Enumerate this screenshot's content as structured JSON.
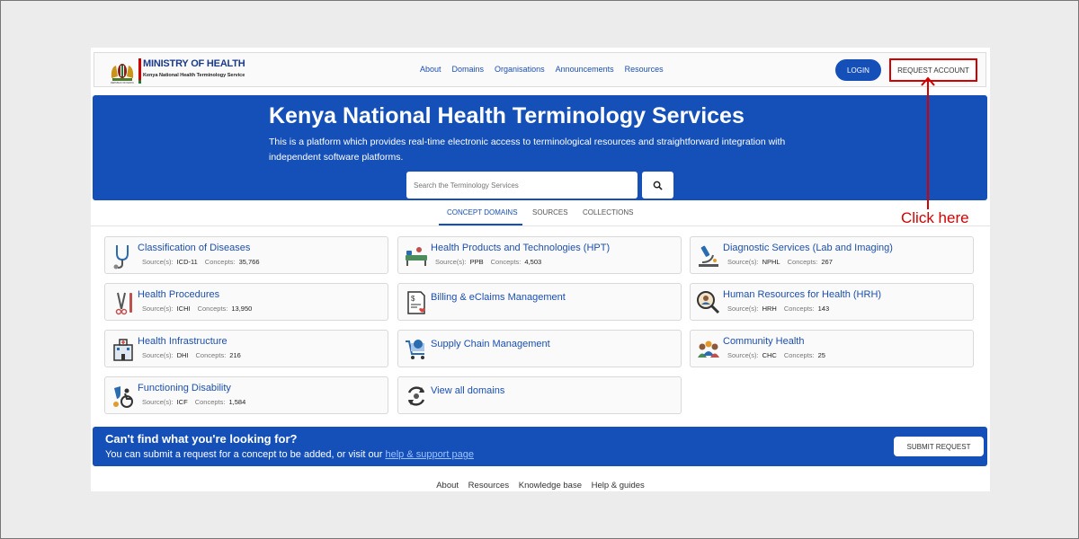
{
  "header": {
    "logo_title": "MINISTRY OF HEALTH",
    "logo_subtitle": "Kenya National Health Terminology Service",
    "nav": [
      "About",
      "Domains",
      "Organisations",
      "Announcements",
      "Resources"
    ],
    "login_label": "LOGIN",
    "request_account_label": "REQUEST ACCOUNT"
  },
  "hero": {
    "title": "Kenya National Health Terminology Services",
    "description": "This is a platform which provides real-time electronic access to terminological resources and straightforward integration with independent software platforms.",
    "search_placeholder": "Search the Terminology Services"
  },
  "tabs": [
    "CONCEPT DOMAINS",
    "SOURCES",
    "COLLECTIONS"
  ],
  "labels": {
    "source": "Source(s):",
    "concepts": "Concepts:"
  },
  "cards": [
    {
      "title": "Classification of Diseases",
      "source": "ICD-11",
      "concepts": "35,766",
      "icon": "stethoscope-icon"
    },
    {
      "title": "Health Products and Technologies (HPT)",
      "source": "PPB",
      "concepts": "4,503",
      "icon": "hospital-bed-icon"
    },
    {
      "title": "Diagnostic Services (Lab and Imaging)",
      "source": "NPHL",
      "concepts": "267",
      "icon": "microscope-icon"
    },
    {
      "title": "Health Procedures",
      "source": "ICHI",
      "concepts": "13,950",
      "icon": "surgical-tools-icon"
    },
    {
      "title": "Billing & eClaims Management",
      "icon": "invoice-icon"
    },
    {
      "title": "Human Resources for Health (HRH)",
      "source": "HRH",
      "concepts": "143",
      "icon": "hr-search-icon"
    },
    {
      "title": "Health Infrastructure",
      "source": "DHI",
      "concepts": "216",
      "icon": "hospital-building-icon"
    },
    {
      "title": "Supply Chain Management",
      "icon": "shopping-cart-icon"
    },
    {
      "title": "Community Health",
      "source": "CHC",
      "concepts": "25",
      "icon": "community-icon"
    },
    {
      "title": "Functioning Disability",
      "source": "ICF",
      "concepts": "1,584",
      "icon": "wheelchair-icon"
    },
    {
      "title": "View all domains",
      "icon": "refresh-icon"
    }
  ],
  "banner": {
    "heading": "Can't find what you're looking for?",
    "text": "You can submit a request for a concept to be added, or visit our",
    "link": "help & support page",
    "button": "SUBMIT REQUEST"
  },
  "footer": [
    "About",
    "Resources",
    "Knowledge base",
    "Help & guides"
  ],
  "annotation": {
    "text": "Click here",
    "color": "#d40000"
  },
  "colors": {
    "primary": "#1550b8",
    "link": "#1b4fb0"
  }
}
